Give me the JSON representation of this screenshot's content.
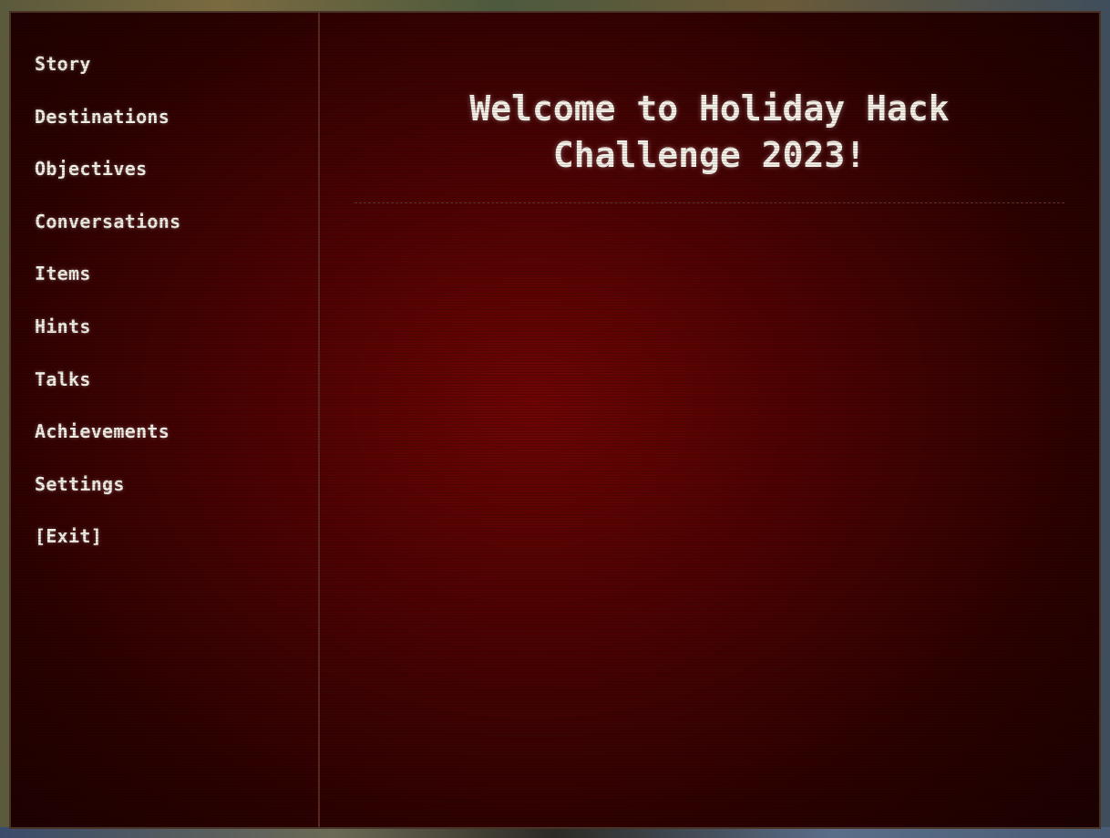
{
  "menu": {
    "items": [
      {
        "label": "Story"
      },
      {
        "label": "Destinations"
      },
      {
        "label": "Objectives"
      },
      {
        "label": "Conversations"
      },
      {
        "label": "Items"
      },
      {
        "label": "Hints"
      },
      {
        "label": "Talks"
      },
      {
        "label": "Achievements"
      },
      {
        "label": "Settings"
      },
      {
        "label": "[Exit]"
      }
    ]
  },
  "main": {
    "title_line1": "Welcome to Holiday Hack",
    "title_line2": "Challenge 2023!"
  },
  "colors": {
    "panel_center": "#6e0404",
    "panel_edge": "#1c0101",
    "text": "#f2efe6",
    "border": "#4a3226"
  }
}
